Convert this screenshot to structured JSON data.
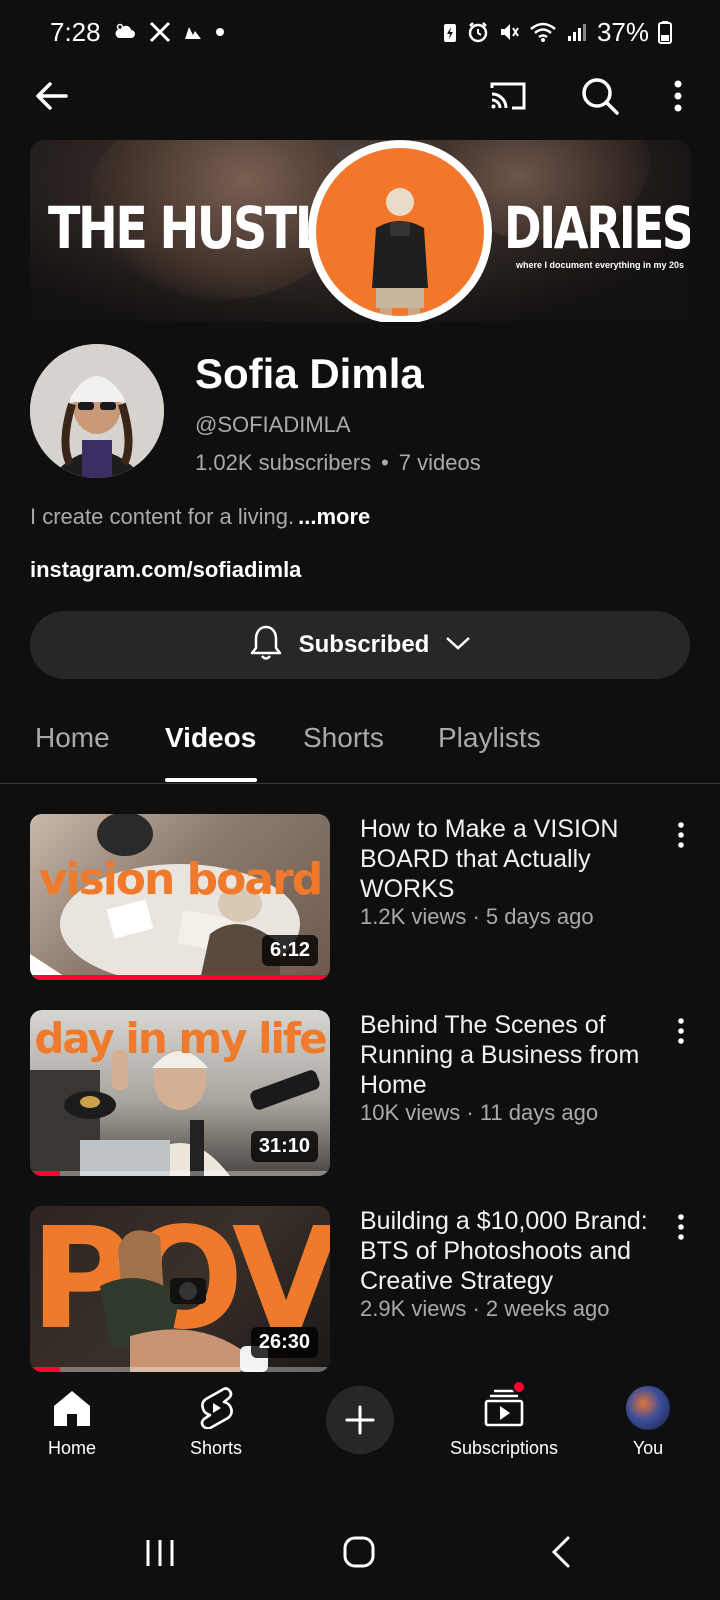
{
  "status_bar": {
    "time": "7:28",
    "battery": "37%"
  },
  "banner": {
    "title_left": "THE HUSTLE",
    "title_right": "DIARIES",
    "tagline": "where I document everything in my 20s"
  },
  "channel": {
    "name": "Sofia Dimla",
    "handle": "@SOFIADIMLA",
    "subscribers": "1.02K subscribers",
    "separator": "•",
    "video_count": "7 videos",
    "description": "I create content for a living.",
    "more_label": "...more",
    "link": "instagram.com/sofiadimla"
  },
  "subscribe_button": {
    "label": "Subscribed"
  },
  "tabs": [
    {
      "label": "Home",
      "active": false
    },
    {
      "label": "Videos",
      "active": true
    },
    {
      "label": "Shorts",
      "active": false
    },
    {
      "label": "Playlists",
      "active": false
    }
  ],
  "videos": [
    {
      "title": "How to Make a VISION BOARD that Actually WORKS",
      "meta": "1.2K views · 5 days ago",
      "duration": "6:12",
      "thumb_text": "vision board",
      "watched_fraction": 1.0
    },
    {
      "title": "Behind The Scenes of Running a Business from Home",
      "meta": "10K views · 11 days ago",
      "duration": "31:10",
      "thumb_text": "day in my life",
      "watched_fraction": 0.1
    },
    {
      "title": "Building a $10,000 Brand: BTS of Photoshoots and Creative Strategy",
      "meta": "2.9K views · 2 weeks ago",
      "duration": "26:30",
      "thumb_text": "POV",
      "watched_fraction": 0.1
    }
  ],
  "bottom_nav": {
    "home": "Home",
    "shorts": "Shorts",
    "subscriptions": "Subscriptions",
    "you": "You"
  },
  "colors": {
    "background": "#0f0f0f",
    "accent_red": "#ff0033",
    "thumb_orange": "#f07a2c",
    "secondary_text": "#aaaaaa"
  }
}
